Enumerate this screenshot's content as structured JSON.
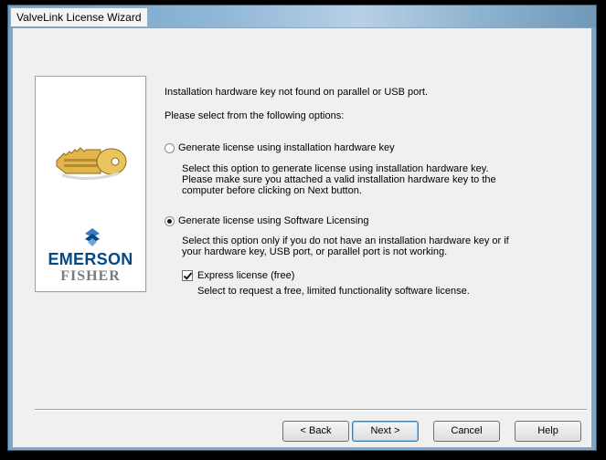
{
  "window": {
    "title": "ValveLink License Wizard"
  },
  "side_panel": {
    "brand_primary": "EMERSON",
    "brand_secondary": "FISHER",
    "icon": "key-icon"
  },
  "content": {
    "intro": "Installation hardware key not found on parallel or USB port.",
    "prompt": "Please select from the following options:",
    "option_hardware": {
      "label": "Generate license using installation hardware key",
      "selected": false,
      "description": [
        "Select this option to generate license using installation hardware key.",
        "Please make sure you attached a valid installation hardware key to the",
        "computer before clicking on Next button."
      ]
    },
    "option_software": {
      "label": "Generate license using Software Licensing",
      "selected": true,
      "description": [
        "Select this option only if you do not have an installation hardware key or if",
        "your hardware key, USB port, or parallel port is not working."
      ]
    },
    "express": {
      "label": "Express license (free)",
      "checked": true,
      "description": "Select to request a free, limited functionality software license."
    }
  },
  "buttons": {
    "back": "< Back",
    "next": "Next >",
    "cancel": "Cancel",
    "help": "Help"
  },
  "colors": {
    "brand_blue": "#004b87",
    "brand_gray": "#7b7b7b"
  }
}
